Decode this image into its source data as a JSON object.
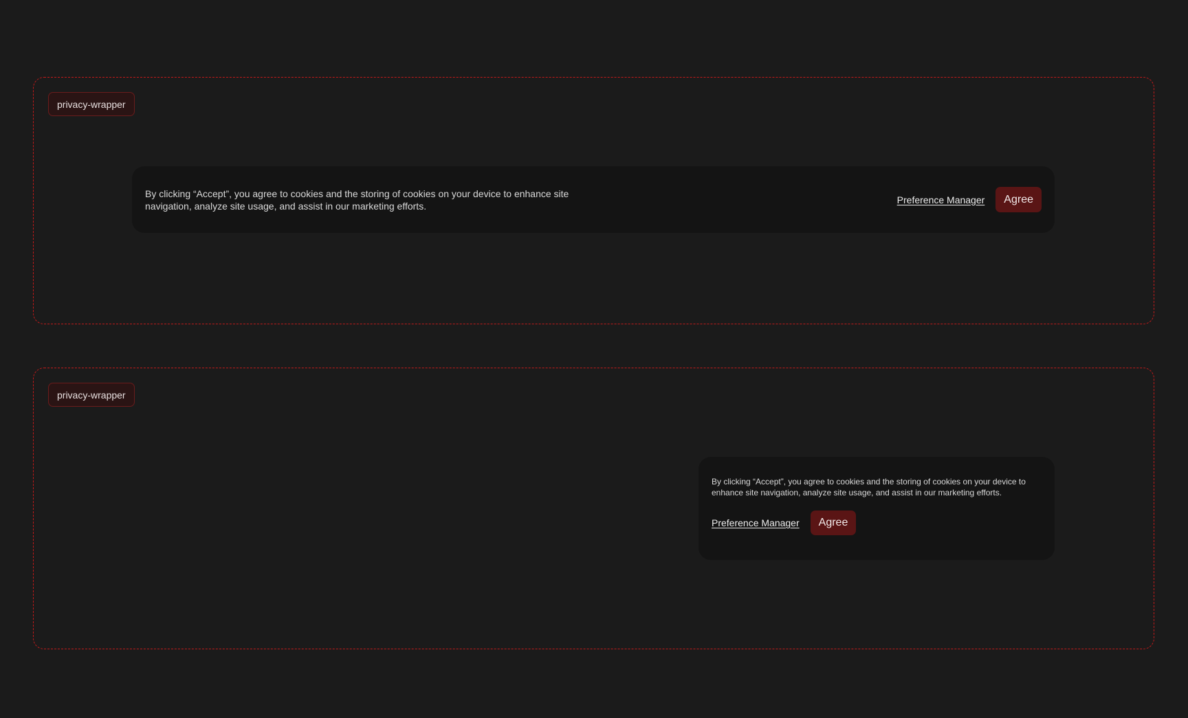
{
  "frames": [
    {
      "tag": "privacy-wrapper",
      "banner": {
        "message": "By clicking “Accept”, you agree to cookies and the storing of cookies on your device to enhance site navigation, analyze site usage, and assist in our marketing efforts.",
        "preference_label": "Preference Manager",
        "agree_label": "Agree"
      }
    },
    {
      "tag": "privacy-wrapper",
      "banner": {
        "message": "By clicking “Accept”, you agree to cookies and the storing of cookies on your device to enhance site navigation, analyze site usage, and assist in our marketing efforts.",
        "preference_label": "Preference Manager",
        "agree_label": "Agree"
      }
    }
  ],
  "colors": {
    "background": "#1b1b1b",
    "frame_border": "#c41a1a",
    "banner_bg": "#141414",
    "agree_bg": "#5a1515"
  }
}
